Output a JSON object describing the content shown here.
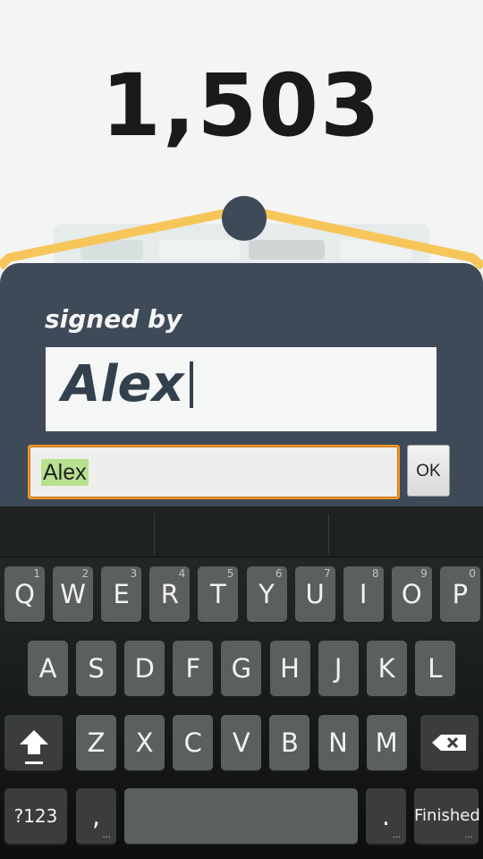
{
  "score": "1,503",
  "sign": {
    "label": "signed by",
    "value": "Alex"
  },
  "edit_field": {
    "value": "Alex"
  },
  "ok_label": "OK",
  "colors": {
    "board": "#3f4a59",
    "hanger_rope": "#f7c65a",
    "field_focus": "#f39a22",
    "selection": "#b7e08f"
  },
  "keyboard": {
    "row1": [
      {
        "label": "Q",
        "num": "1"
      },
      {
        "label": "W",
        "num": "2"
      },
      {
        "label": "E",
        "num": "3"
      },
      {
        "label": "R",
        "num": "4"
      },
      {
        "label": "T",
        "num": "5"
      },
      {
        "label": "Y",
        "num": "6"
      },
      {
        "label": "U",
        "num": "7"
      },
      {
        "label": "I",
        "num": "8"
      },
      {
        "label": "O",
        "num": "9"
      },
      {
        "label": "P",
        "num": "0"
      }
    ],
    "row2": [
      "A",
      "S",
      "D",
      "F",
      "G",
      "H",
      "J",
      "K",
      "L"
    ],
    "row3": [
      "Z",
      "X",
      "C",
      "V",
      "B",
      "N",
      "M"
    ],
    "symbols_label": "?123",
    "comma_label": ",",
    "period_label": ".",
    "finish_label": "Finished",
    "shift_icon": "shift-arrow-icon",
    "backspace_icon": "backspace-icon"
  }
}
